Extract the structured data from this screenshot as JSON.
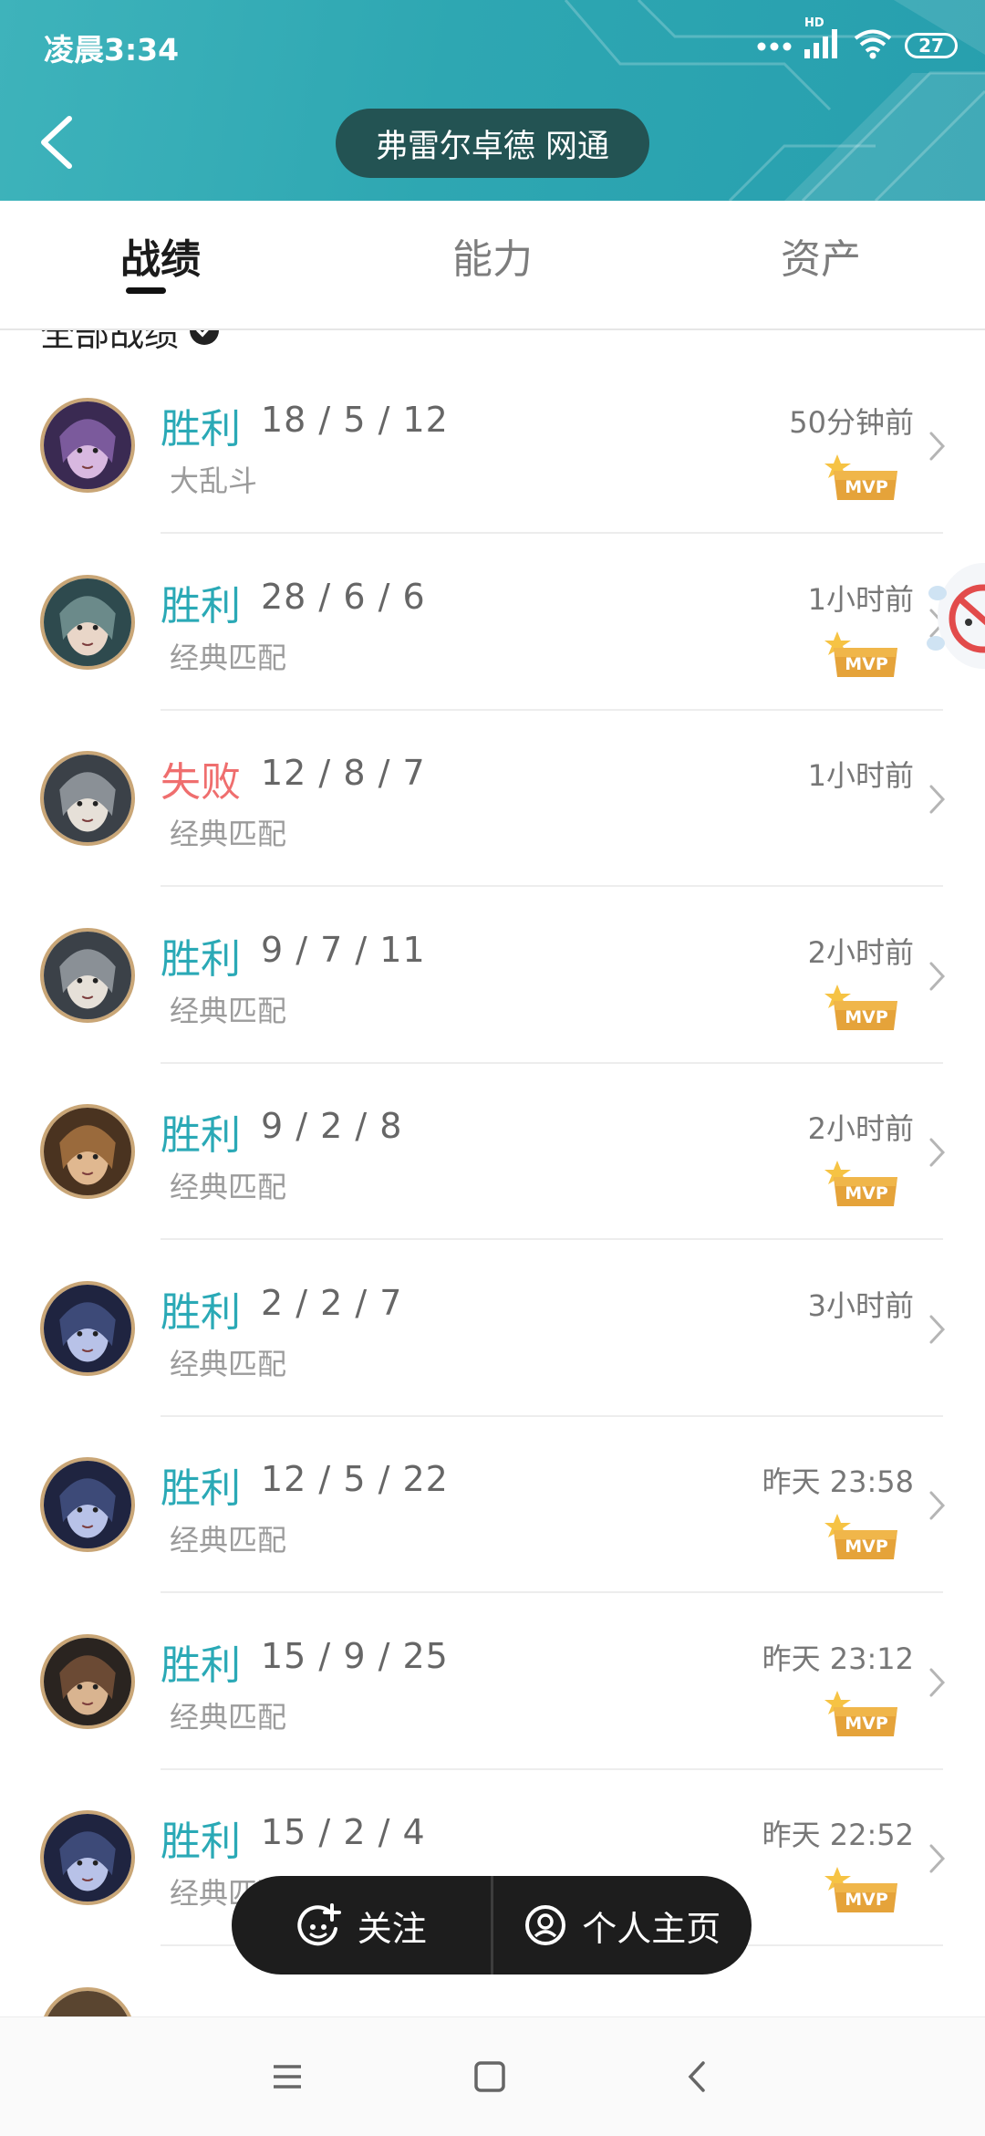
{
  "status_bar": {
    "time": "凌晨3:34",
    "network": "HD",
    "battery": "27",
    "icons": [
      "dots-icon",
      "signal-icon",
      "wifi-icon",
      "battery-icon"
    ]
  },
  "header": {
    "title": "弗雷尔卓德 网通",
    "back_icon": "back-arrow-icon",
    "colors": {
      "header_bg": "#2ea7b2",
      "title_pill": "#235353"
    }
  },
  "tabs": [
    {
      "label": "战绩",
      "active": true
    },
    {
      "label": "能力",
      "active": false
    },
    {
      "label": "资产",
      "active": false
    }
  ],
  "filter": {
    "label": "全部战绩",
    "icon": "check-circle-icon"
  },
  "matches": [
    {
      "result": "胜利",
      "outcome": "win",
      "kda": "18 / 5 / 12",
      "mode": "大乱斗",
      "time": "50分钟前",
      "mvp": true
    },
    {
      "result": "胜利",
      "outcome": "win",
      "kda": "28 / 6 / 6",
      "mode": "经典匹配",
      "time": "1小时前",
      "mvp": true
    },
    {
      "result": "失败",
      "outcome": "lose",
      "kda": "12 / 8 / 7",
      "mode": "经典匹配",
      "time": "1小时前",
      "mvp": false
    },
    {
      "result": "胜利",
      "outcome": "win",
      "kda": "9 / 7 / 11",
      "mode": "经典匹配",
      "time": "2小时前",
      "mvp": true
    },
    {
      "result": "胜利",
      "outcome": "win",
      "kda": "9 / 2 / 8",
      "mode": "经典匹配",
      "time": "2小时前",
      "mvp": true
    },
    {
      "result": "胜利",
      "outcome": "win",
      "kda": "2 / 2 / 7",
      "mode": "经典匹配",
      "time": "3小时前",
      "mvp": false
    },
    {
      "result": "胜利",
      "outcome": "win",
      "kda": "12 / 5 / 22",
      "mode": "经典匹配",
      "time": "昨天 23:58",
      "mvp": true
    },
    {
      "result": "胜利",
      "outcome": "win",
      "kda": "15 / 9 / 25",
      "mode": "经典匹配",
      "time": "昨天 23:12",
      "mvp": true
    },
    {
      "result": "胜利",
      "outcome": "win",
      "kda": "15 / 2 / 4",
      "mode": "经典匹配",
      "time": "昨天 22:52",
      "mvp": true
    }
  ],
  "mvp_badge": "MVP",
  "actions": {
    "follow": "关注",
    "profile": "个人主页"
  },
  "nav": [
    "menu-icon",
    "home-icon",
    "back-icon"
  ],
  "colors": {
    "win": "#2aa9b6",
    "lose": "#ef6e6e",
    "mvp": "#e8a33c"
  }
}
